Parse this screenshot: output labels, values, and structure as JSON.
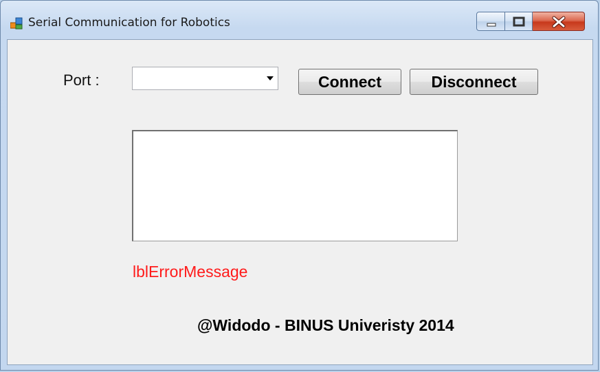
{
  "window": {
    "title": "Serial Communication for Robotics",
    "icon": "windows-forms-app-icon",
    "controls": {
      "minimize": "minimize-icon",
      "maximize": "maximize-icon",
      "close": "close-icon"
    }
  },
  "form": {
    "port_label": "Port :",
    "port_value": "",
    "connect_label": "Connect",
    "disconnect_label": "Disconnect",
    "output_text": "",
    "error_label": "lblErrorMessage",
    "credit": "@Widodo - BINUS Univeristy 2014"
  },
  "colors": {
    "error": "#ff1a1a",
    "client_bg": "#f0f0f0",
    "close_button": "#c7391c"
  }
}
